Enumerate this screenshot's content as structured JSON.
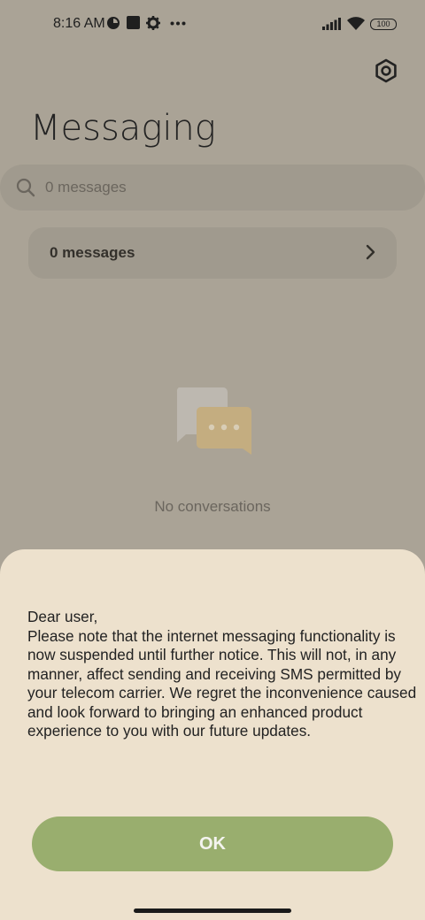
{
  "status_bar": {
    "time": "8:16 AM",
    "battery": "100",
    "icons": [
      "data-saver-icon",
      "square-app-icon",
      "settings-icon",
      "more-dots-icon",
      "signal-icon",
      "wifi-icon",
      "battery-icon"
    ]
  },
  "header": {
    "title": "Messaging",
    "settings_icon": "gear-icon"
  },
  "search": {
    "placeholder": "0 messages"
  },
  "summary_card": {
    "label": "0 messages"
  },
  "empty_state": {
    "text": "No conversations"
  },
  "dialog": {
    "message": "Dear user,\nPlease note that the internet messaging functionality is now suspended until further notice. This will not, in any manner, affect sending and receiving SMS permitted by your telecom carrier. We regret the inconvenience caused and look forward to bringing an enhanced product experience to you with our future updates.",
    "ok_label": "OK"
  },
  "colors": {
    "background_dimmed": "#aaa396",
    "sheet": "#ede1cd",
    "ok_button": "#99ae6e"
  }
}
